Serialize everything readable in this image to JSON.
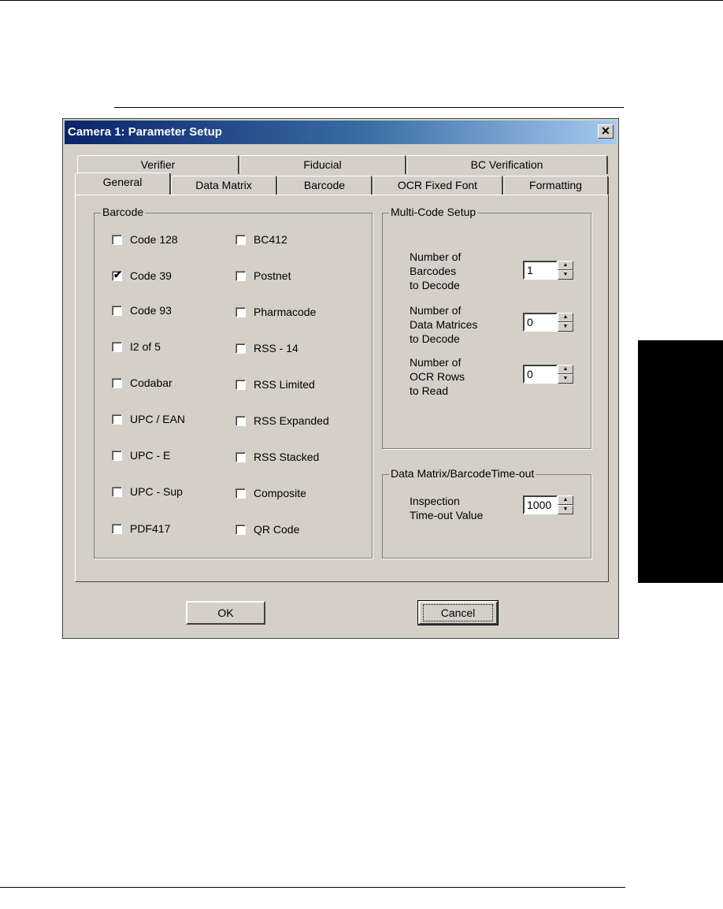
{
  "window": {
    "title": "Camera 1: Parameter Setup",
    "close_glyph": "✕"
  },
  "tabs_back": [
    {
      "label": "Verifier"
    },
    {
      "label": "Fiducial"
    },
    {
      "label": "BC Verification"
    }
  ],
  "tabs_front": [
    {
      "label": "General",
      "active": true
    },
    {
      "label": "Data Matrix"
    },
    {
      "label": "Barcode"
    },
    {
      "label": "OCR Fixed Font"
    },
    {
      "label": "Formatting"
    }
  ],
  "barcode_group": {
    "legend": "Barcode",
    "checkboxes": [
      {
        "label": "Code 128",
        "checked": false
      },
      {
        "label": "Code 39",
        "checked": true
      },
      {
        "label": "Code 93",
        "checked": false
      },
      {
        "label": "I2 of 5",
        "checked": false
      },
      {
        "label": "Codabar",
        "checked": false
      },
      {
        "label": "UPC / EAN",
        "checked": false
      },
      {
        "label": "UPC - E",
        "checked": false
      },
      {
        "label": "UPC - Sup",
        "checked": false
      },
      {
        "label": "PDF417",
        "checked": false
      },
      {
        "label": "BC412",
        "checked": false
      },
      {
        "label": "Postnet",
        "checked": false
      },
      {
        "label": "Pharmacode",
        "checked": false
      },
      {
        "label": "RSS - 14",
        "checked": false
      },
      {
        "label": "RSS Limited",
        "checked": false
      },
      {
        "label": "RSS Expanded",
        "checked": false
      },
      {
        "label": "RSS Stacked",
        "checked": false
      },
      {
        "label": "Composite",
        "checked": false
      },
      {
        "label": "QR Code",
        "checked": false
      }
    ],
    "check_glyph": "✔"
  },
  "multicode_group": {
    "legend": "Multi-Code Setup",
    "fields": [
      {
        "label_lines": [
          "Number of",
          "Barcodes",
          "to Decode"
        ],
        "value": "1"
      },
      {
        "label_lines": [
          "Number of",
          "Data Matrices",
          "to Decode"
        ],
        "value": "0"
      },
      {
        "label_lines": [
          "Number of",
          "OCR Rows",
          "to Read"
        ],
        "value": "0"
      }
    ]
  },
  "timeout_group": {
    "legend": "Data Matrix/BarcodeTime-out",
    "label_lines": [
      "Inspection",
      "Time-out Value"
    ],
    "value": "1000"
  },
  "spin_glyphs": {
    "up": "▲",
    "down": "▼"
  },
  "buttons": {
    "ok": "OK",
    "cancel": "Cancel"
  }
}
